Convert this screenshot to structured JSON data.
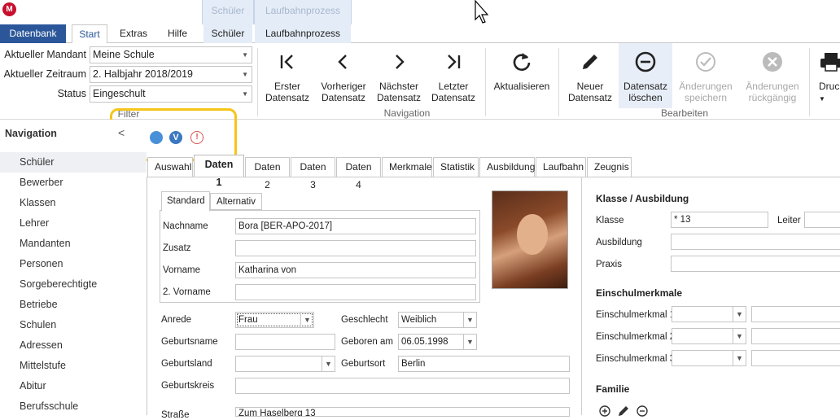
{
  "titlebar": {
    "logo": "M"
  },
  "context_tabs": [
    {
      "header": "Schüler",
      "label": "Schüler"
    },
    {
      "header": "Laufbahnprozess",
      "label": "Laufbahnprozess"
    }
  ],
  "ribbon_tabs": {
    "file": "Datenbank",
    "start": "Start",
    "extras": "Extras",
    "help": "Hilfe"
  },
  "fields": {
    "mandant_label": "Aktueller Mandant",
    "mandant_value": "Meine Schule",
    "zeitraum_label": "Aktueller Zeitraum",
    "zeitraum_value": "2. Halbjahr 2018/2019",
    "status_label": "Status",
    "status_value": "Eingeschult",
    "filter_label": "Filter"
  },
  "ribbon_buttons": {
    "first": "Erster\nDatensatz",
    "prev": "Vorheriger\nDatensatz",
    "next": "Nächster\nDatensatz",
    "last": "Letzter\nDatensatz",
    "refresh": "Aktualisieren",
    "new": "Neuer\nDatensatz",
    "delete": "Datensatz\nlöschen",
    "save": "Änderungen\nspeichern",
    "undo": "Änderungen\nrückgängig",
    "print": "Druc"
  },
  "ribbon_groups": {
    "navigation": "Navigation",
    "edit": "Bearbeiten"
  },
  "nav": {
    "title": "Navigation",
    "items": [
      "Schüler",
      "Bewerber",
      "Klassen",
      "Lehrer",
      "Mandanten",
      "Personen",
      "Sorgeberechtigte",
      "Betriebe",
      "Schulen",
      "Adressen",
      "Mittelstufe",
      "Abitur",
      "Berufsschule"
    ]
  },
  "filter_icons": {
    "v_label": "V",
    "warn_label": "!"
  },
  "detail_tabs": [
    "Auswahl",
    "Daten 1",
    "Daten 2",
    "Daten 3",
    "Daten 4",
    "Merkmale",
    "Statistik",
    "Ausbildung",
    "Laufbahn",
    "Zeugnis"
  ],
  "sub_tabs": [
    "Standard",
    "Alternativ"
  ],
  "person": {
    "nachname_label": "Nachname",
    "nachname": "Bora [BER-APO-2017]",
    "zusatz_label": "Zusatz",
    "zusatz": "",
    "vorname_label": "Vorname",
    "vorname": "Katharina von",
    "vorname2_label": "2. Vorname",
    "vorname2": "",
    "anrede_label": "Anrede",
    "anrede": "Frau",
    "geschlecht_label": "Geschlecht",
    "geschlecht": "Weiblich",
    "geburtsname_label": "Geburtsname",
    "geburtsname": "",
    "geboren_label": "Geboren am",
    "geboren": "06.05.1998",
    "geburtsland_label": "Geburtsland",
    "geburtsland": "",
    "geburtsort_label": "Geburtsort",
    "geburtsort": "Berlin",
    "geburtskreis_label": "Geburtskreis",
    "geburtskreis": "",
    "strasse_label": "Straße",
    "strasse": "Zum Haselberg 13"
  },
  "klasse": {
    "title": "Klasse / Ausbildung",
    "klasse_label": "Klasse",
    "klasse": "* 13",
    "leiter_label": "Leiter",
    "ausbildung_label": "Ausbildung",
    "praxis_label": "Praxis"
  },
  "einschul": {
    "title": "Einschulmerkmale",
    "m1": "Einschulmerkmal 1",
    "m2": "Einschulmerkmal 2",
    "m3": "Einschulmerkmal 3"
  },
  "familie": {
    "title": "Familie"
  },
  "colors": {
    "accent": "#2b579a",
    "highlight": "#f5c518",
    "blue_dot": "#4a90d9",
    "warn": "#d9534f"
  }
}
